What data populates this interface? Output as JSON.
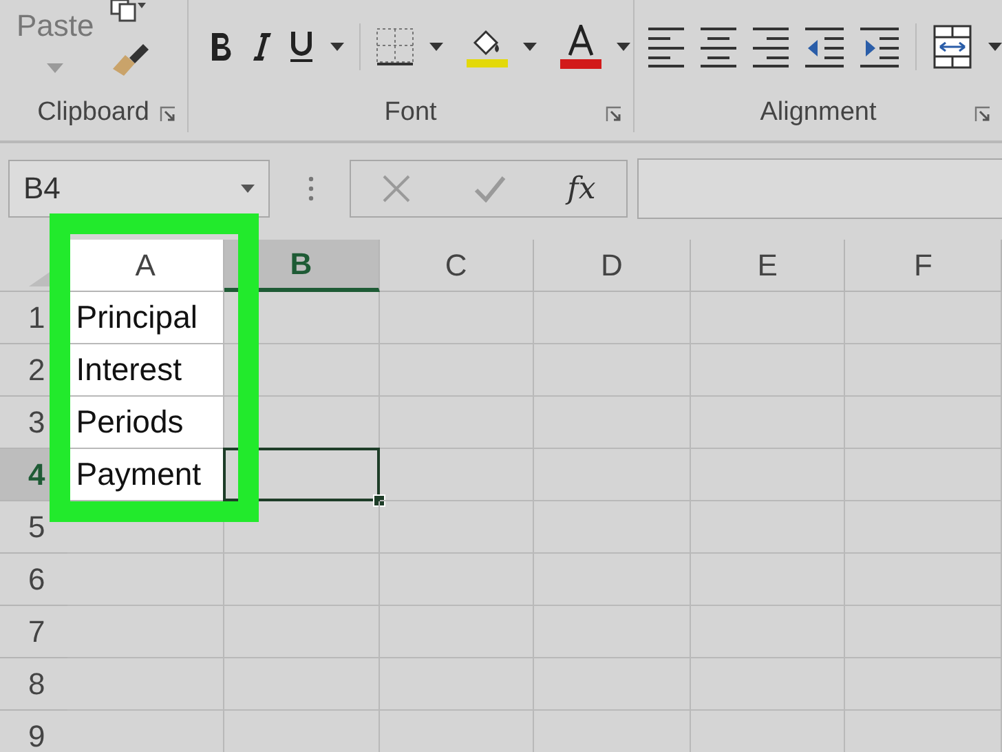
{
  "ribbon": {
    "groups": [
      {
        "kind": "clipboard",
        "label": "Clipboard",
        "paste_label": "Paste"
      },
      {
        "kind": "font",
        "label": "Font"
      },
      {
        "kind": "alignment",
        "label": "Alignment"
      }
    ]
  },
  "formula_bar": {
    "name_box": "B4",
    "function_label": "fx"
  },
  "sheet": {
    "columns": [
      {
        "label": "A",
        "selected": false,
        "highlighted": true
      },
      {
        "label": "B",
        "selected": true,
        "highlighted": false
      },
      {
        "label": "C",
        "selected": false,
        "highlighted": false
      },
      {
        "label": "D",
        "selected": false,
        "highlighted": false
      },
      {
        "label": "E",
        "selected": false,
        "highlighted": false
      },
      {
        "label": "F",
        "selected": false,
        "highlighted": false
      }
    ],
    "rows": [
      {
        "label": "1",
        "selected": false,
        "cells": [
          "Principal"
        ]
      },
      {
        "label": "2",
        "selected": false,
        "cells": [
          "Interest"
        ]
      },
      {
        "label": "3",
        "selected": false,
        "cells": [
          "Periods"
        ]
      },
      {
        "label": "4",
        "selected": true,
        "cells": [
          "Payment"
        ]
      },
      {
        "label": "5",
        "selected": false,
        "cells": []
      },
      {
        "label": "6",
        "selected": false,
        "cells": []
      },
      {
        "label": "7",
        "selected": false,
        "cells": []
      },
      {
        "label": "8",
        "selected": false,
        "cells": []
      },
      {
        "label": "9",
        "selected": false,
        "cells": []
      }
    ]
  }
}
